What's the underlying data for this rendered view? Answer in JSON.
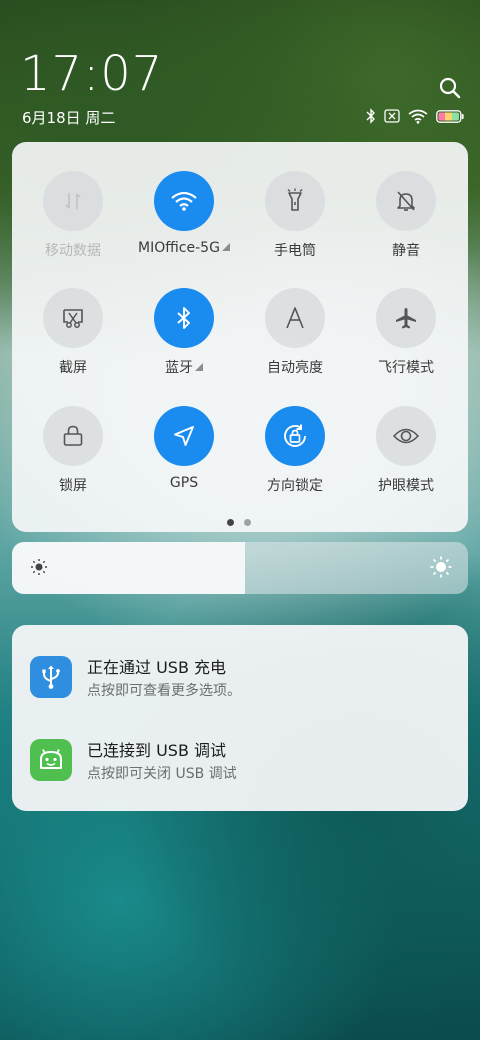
{
  "clock": {
    "time": "17:07",
    "date": "6月18日 周二"
  },
  "status_icons": [
    "bluetooth-icon",
    "no-sim-icon",
    "wifi-icon",
    "battery-icon"
  ],
  "quick_settings": {
    "tiles": [
      {
        "label": "移动数据",
        "icon": "mobile-data-icon",
        "active": false,
        "disabled": true
      },
      {
        "label": "MIOffice-5G",
        "icon": "wifi-icon",
        "active": true,
        "expandable": true
      },
      {
        "label": "手电筒",
        "icon": "flashlight-icon",
        "active": false
      },
      {
        "label": "静音",
        "icon": "mute-bell-icon",
        "active": false
      },
      {
        "label": "截屏",
        "icon": "screenshot-icon",
        "active": false
      },
      {
        "label": "蓝牙",
        "icon": "bluetooth-icon",
        "active": true,
        "expandable": true
      },
      {
        "label": "自动亮度",
        "icon": "auto-brightness-icon",
        "active": false
      },
      {
        "label": "飞行模式",
        "icon": "airplane-icon",
        "active": false
      },
      {
        "label": "锁屏",
        "icon": "lock-icon",
        "active": false
      },
      {
        "label": "GPS",
        "icon": "location-arrow-icon",
        "active": true
      },
      {
        "label": "方向锁定",
        "icon": "rotation-lock-icon",
        "active": true
      },
      {
        "label": "护眼模式",
        "icon": "eye-icon",
        "active": false
      }
    ],
    "page": {
      "current": 1,
      "total": 2
    }
  },
  "brightness": {
    "level": 0.51
  },
  "notifications": [
    {
      "title": "正在通过 USB 充电",
      "subtitle": "点按即可查看更多选项。",
      "icon": "usb-icon",
      "color": "#2f8ee0"
    },
    {
      "title": "已连接到 USB 调试",
      "subtitle": "点按即可关闭 USB 调试",
      "icon": "android-icon",
      "color": "#4fbf4f"
    }
  ],
  "colors": {
    "accent": "#1a8cf0",
    "panel": "#f4f6f7"
  }
}
